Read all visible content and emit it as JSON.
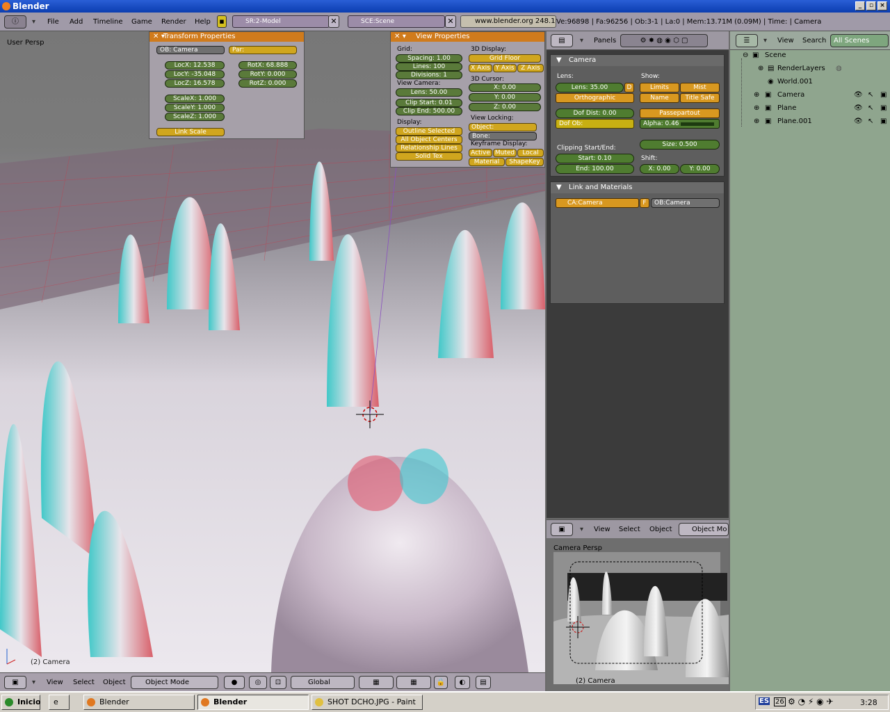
{
  "window": {
    "title": "Blender"
  },
  "header": {
    "menus": [
      "File",
      "Add",
      "Timeline",
      "Game",
      "Render",
      "Help"
    ],
    "screen": "SR:2-Model",
    "scene": "SCE:Scene",
    "url": "www.blender.org 248.1",
    "stats": "Ve:96898 | Fa:96256 | Ob:3-1 | La:0 | Mem:13.71M (0.09M) | Time: | Camera"
  },
  "viewport": {
    "label": "User Persp",
    "object_name": "(2) Camera"
  },
  "transform": {
    "title": "Transform Properties",
    "ob": "OB: Camera",
    "par": "Par:",
    "loc": [
      "LocX: 12.538",
      "LocY: -35.048",
      "LocZ: 16.578"
    ],
    "rot": [
      "RotX: 68.888",
      "RotY: 0.000",
      "RotZ: 0.000"
    ],
    "scale": [
      "ScaleX: 1.000",
      "ScaleY: 1.000",
      "ScaleZ: 1.000"
    ],
    "link_scale": "Link Scale"
  },
  "viewprops": {
    "title": "View Properties",
    "grid_label": "Grid:",
    "spacing": "Spacing: 1.00",
    "lines": "Lines: 100",
    "divisions": "Divisions: 1",
    "view_camera": "View Camera:",
    "lens": "Lens: 50.00",
    "clip_start": "Clip Start: 0.01",
    "clip_end": "Clip End: 500.00",
    "display": "Display:",
    "display_items": [
      "Outline Selected",
      "All Object Centers",
      "Relationship Lines",
      "Solid Tex"
    ],
    "d3_display": "3D Display:",
    "grid_floor": "Grid Floor",
    "axes": [
      "X Axis",
      "Y Axis",
      "Z Axis"
    ],
    "cursor": "3D Cursor:",
    "cx": "X: 0.00",
    "cy": "Y: 0.00",
    "cz": "Z: 0.00",
    "view_locking": "View Locking:",
    "object": "Object:",
    "bone": "Bone:",
    "keyframe": "Keyframe Display:",
    "kf_items": [
      "Active",
      "Muted",
      "Local",
      "Material",
      "ShapeKey"
    ]
  },
  "vpheader": {
    "menus": [
      "View",
      "Select",
      "Object"
    ],
    "mode": "Object Mode",
    "orient": "Global"
  },
  "buttons": {
    "panels": "Panels",
    "camera_panel": "Camera",
    "lens_label": "Lens:",
    "lens": "Lens: 35.00",
    "d": "D",
    "ortho": "Orthographic",
    "show": "Show:",
    "limits": "Limits",
    "mist": "Mist",
    "name": "Name",
    "title_safe": "Title Safe",
    "dof_dist": "Dof Dist: 0.00",
    "dof_ob": "Dof Ob:",
    "passepartout": "Passepartout",
    "alpha": "Alpha: 0.46",
    "clip_label": "Clipping Start/End:",
    "size": "Size: 0.500",
    "start": "Start: 0.10",
    "end": "End: 100.00",
    "shift": "Shift:",
    "sx": "X: 0.00",
    "sy": "Y: 0.00",
    "link_panel": "Link and Materials",
    "ca": "CA:Camera",
    "f": "F",
    "ob": "OB:Camera"
  },
  "cam_view": {
    "menus": [
      "View",
      "Select",
      "Object"
    ],
    "mode": "Object Mo",
    "label": "Camera Persp",
    "object_name": "(2) Camera"
  },
  "outliner": {
    "menus": [
      "View",
      "Search"
    ],
    "filter": "All Scenes",
    "items": [
      "Scene",
      "RenderLayers",
      "World.001",
      "Camera",
      "Plane",
      "Plane.001"
    ]
  },
  "taskbar": {
    "start": "Inicio",
    "tasks": [
      "Blender",
      "Blender",
      "SHOT DCHO.JPG - Paint"
    ],
    "clock": "3:28",
    "lang": "ES",
    "num": "26"
  }
}
